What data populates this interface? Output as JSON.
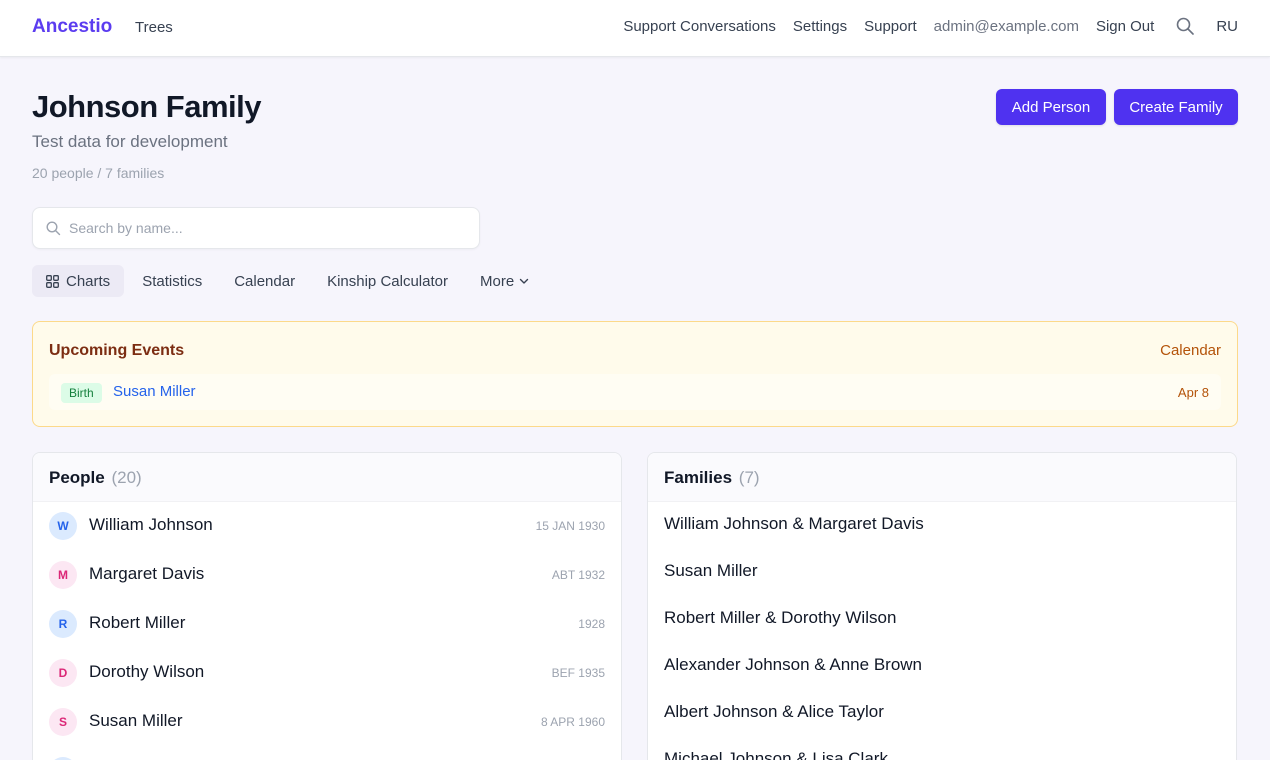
{
  "topbar": {
    "brand": "Ancestio",
    "trees": "Trees",
    "support_conversations": "Support Conversations",
    "settings": "Settings",
    "support": "Support",
    "email": "admin@example.com",
    "sign_out": "Sign Out",
    "search_icon": "search-icon",
    "language": "RU"
  },
  "header": {
    "title": "Johnson Family",
    "subtitle": "Test data for development",
    "stats": "20 people / 7 families",
    "add_person": "Add Person",
    "create_family": "Create Family"
  },
  "search": {
    "placeholder": "Search by name...",
    "value": ""
  },
  "tabs": [
    {
      "label": "Charts",
      "icon": "grid-icon"
    },
    {
      "label": "Statistics"
    },
    {
      "label": "Calendar"
    },
    {
      "label": "Kinship Calculator"
    },
    {
      "label": "More",
      "icon": "chevron-down-icon"
    }
  ],
  "events": {
    "title": "Upcoming Events",
    "link": "Calendar",
    "items": [
      {
        "type": "Birth",
        "name": "Susan Miller",
        "date": "Apr 8"
      }
    ]
  },
  "people": {
    "title": "People",
    "count": "(20)",
    "items": [
      {
        "initial": "W",
        "name": "William Johnson",
        "date": "15 JAN 1930",
        "sex": "m"
      },
      {
        "initial": "M",
        "name": "Margaret Davis",
        "date": "ABT 1932",
        "sex": "f"
      },
      {
        "initial": "R",
        "name": "Robert Miller",
        "date": "1928",
        "sex": "m"
      },
      {
        "initial": "D",
        "name": "Dorothy Wilson",
        "date": "BEF 1935",
        "sex": "f"
      },
      {
        "initial": "S",
        "name": "Susan Miller",
        "date": "8 APR 1960",
        "sex": "f"
      }
    ]
  },
  "families": {
    "title": "Families",
    "count": "(7)",
    "items": [
      "William Johnson & Margaret Davis",
      "Susan Miller",
      "Robert Miller & Dorothy Wilson",
      "Alexander Johnson & Anne Brown",
      "Albert Johnson & Alice Taylor",
      "Michael Johnson & Lisa Clark"
    ]
  },
  "colors": {
    "accent": "#4f32f0",
    "brand": "#5b3cf0",
    "event_bg": "#fffbeb",
    "male_avatar": "#dbeafe",
    "female_avatar": "#fce7f3"
  }
}
